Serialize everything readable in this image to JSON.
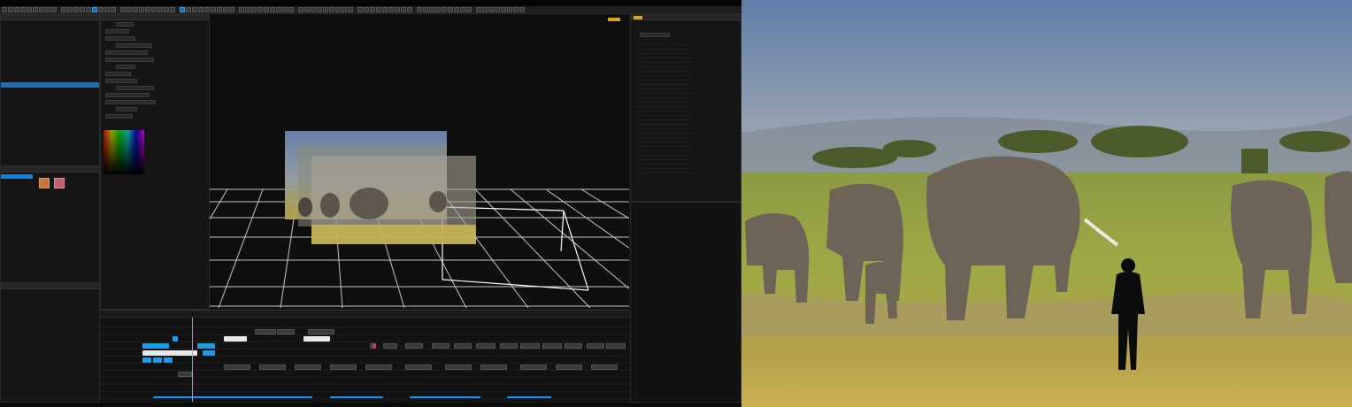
{
  "app": {
    "menu_items": [
      "",
      "",
      "",
      "",
      "",
      "",
      "",
      ""
    ],
    "status_text": ""
  },
  "panels": {
    "scene_tab": "",
    "properties_tab": "",
    "right_tab_1": "",
    "right_tab_2": "",
    "viewport_tag": ""
  },
  "tree": {
    "rows": [
      "",
      "",
      "",
      "",
      "",
      "",
      "",
      "",
      "",
      "",
      "",
      "",
      "",
      "",
      "",
      "",
      "",
      "",
      "",
      "",
      "",
      ""
    ],
    "selected_index": 10
  },
  "colors": {
    "accent_blue": "#1d9be6",
    "playhead": "#d9a21e",
    "tag": "#d6a51c"
  },
  "viewport": {
    "preview_image": "elephant-herd-thumbnail",
    "layers": 3
  },
  "photo": {
    "subject": "elephant-herd-savanna"
  }
}
